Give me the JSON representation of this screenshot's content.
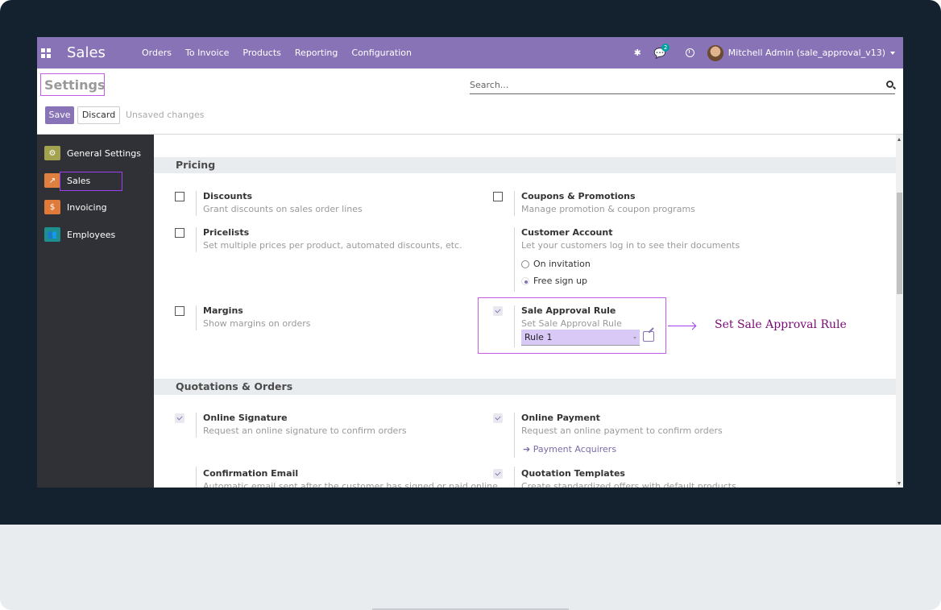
{
  "navbar": {
    "brand": "Sales",
    "menu": [
      "Orders",
      "To Invoice",
      "Products",
      "Reporting",
      "Configuration"
    ],
    "chat_badge": "2",
    "user": "Mitchell Admin (sale_approval_v13)",
    "accent": "#8773b6"
  },
  "control_panel": {
    "title": "Settings",
    "search_placeholder": "Search...",
    "save_label": "Save",
    "discard_label": "Discard",
    "status": "Unsaved changes"
  },
  "sidebar": {
    "items": [
      {
        "label": "General Settings",
        "icon": "gear-icon",
        "color": "#a3a34f"
      },
      {
        "label": "Sales",
        "icon": "chart-icon",
        "color": "#e08040"
      },
      {
        "label": "Invoicing",
        "icon": "invoice-icon",
        "color": "#e07a3a"
      },
      {
        "label": "Employees",
        "icon": "users-icon",
        "color": "#1d8f8f"
      }
    ]
  },
  "sections": {
    "pricing": {
      "title": "Pricing",
      "discounts": {
        "title": "Discounts",
        "desc": "Grant discounts on sales order lines",
        "checked": false
      },
      "coupons": {
        "title": "Coupons & Promotions",
        "desc": "Manage promotion & coupon programs",
        "checked": false
      },
      "pricelists": {
        "title": "Pricelists",
        "desc": "Set multiple prices per product, automated discounts, etc.",
        "checked": false
      },
      "customer_account": {
        "title": "Customer Account",
        "desc": "Let your customers log in to see their documents",
        "options": [
          "On invitation",
          "Free sign up"
        ],
        "selected": "Free sign up"
      },
      "margins": {
        "title": "Margins",
        "desc": "Show margins on orders",
        "checked": false
      },
      "sale_approval": {
        "title": "Sale Approval Rule",
        "desc": "Set Sale Approval Rule",
        "checked": true,
        "value": "Rule 1"
      }
    },
    "quotations": {
      "title": "Quotations & Orders",
      "online_signature": {
        "title": "Online Signature",
        "desc": "Request an online signature to confirm orders",
        "checked": true
      },
      "online_payment": {
        "title": "Online Payment",
        "desc": "Request an online payment to confirm orders",
        "checked": true,
        "link": "Payment Acquirers"
      },
      "confirmation_email": {
        "title": "Confirmation Email",
        "desc": "Automatic email sent after the customer has signed or paid online"
      },
      "quotation_templates": {
        "title": "Quotation Templates",
        "desc": "Create standardized offers with default products",
        "checked": true
      }
    }
  },
  "annotation": "Set  Sale  Approval  Rule"
}
